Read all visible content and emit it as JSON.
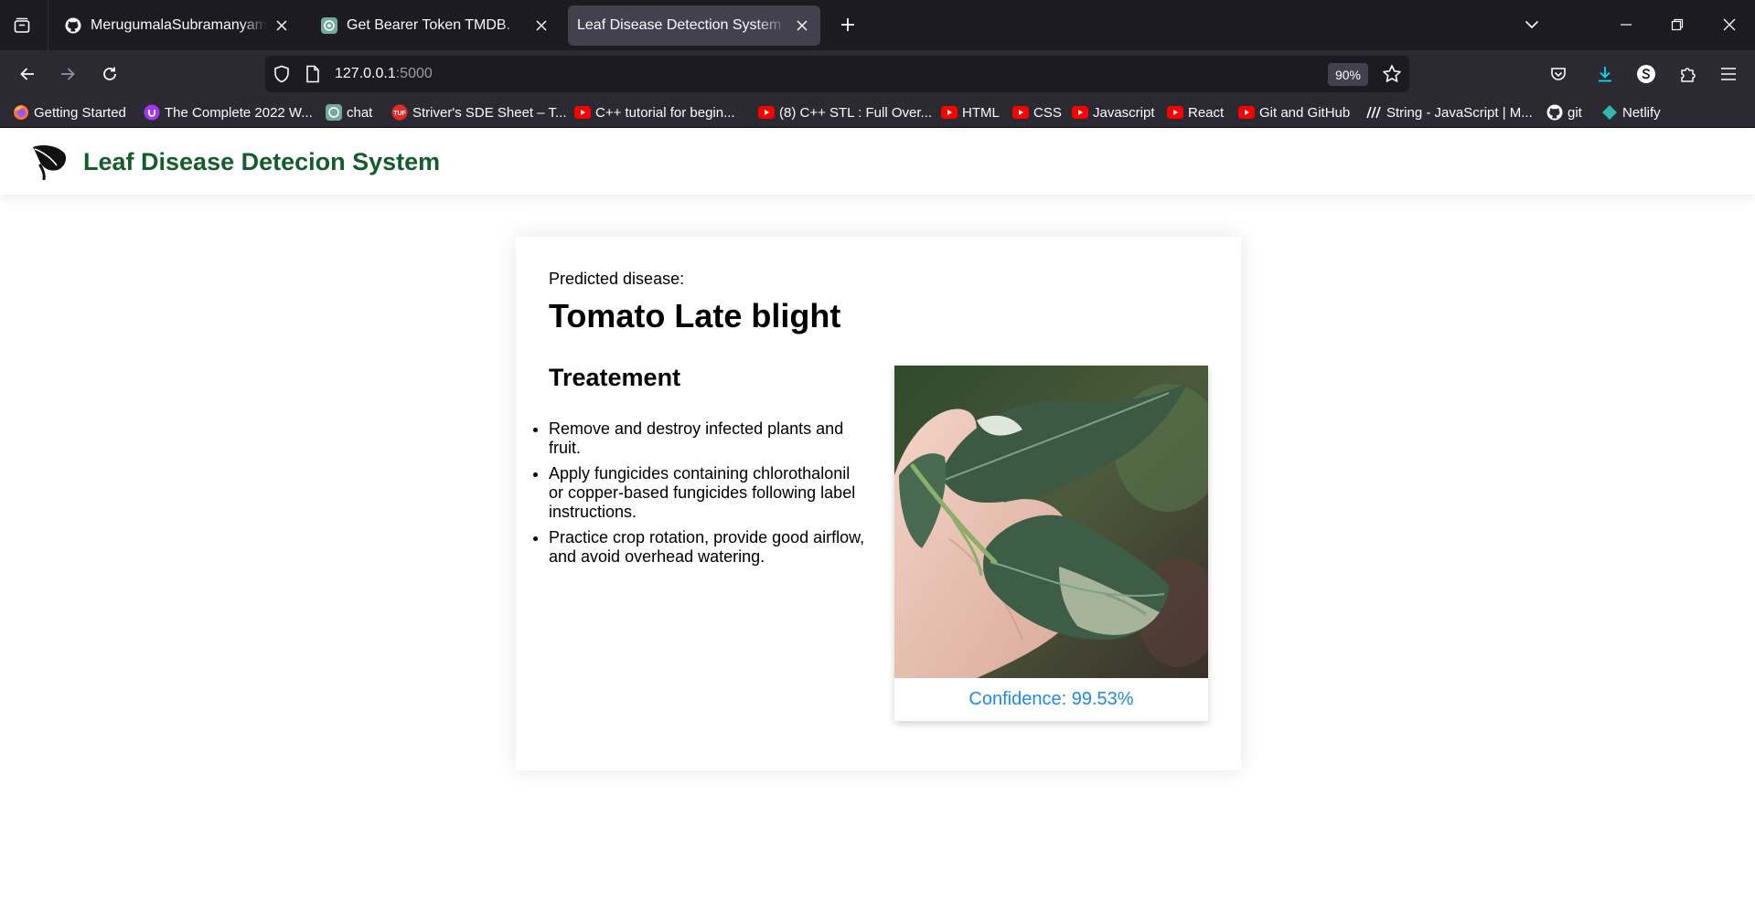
{
  "browser": {
    "tabs": [
      {
        "title": "MerugumalaSubramanyam (sub",
        "icon": "github-icon",
        "active": false
      },
      {
        "title": "Get Bearer Token TMDB.",
        "icon": "chatgpt-icon",
        "active": false
      },
      {
        "title": "Leaf Disease Detection System",
        "icon": "none",
        "active": true
      }
    ],
    "url": {
      "host": "127.0.0.1",
      "port": ":5000"
    },
    "zoom": "90%",
    "bookmarks": [
      {
        "label": "Getting Started",
        "icon": "firefox-icon"
      },
      {
        "label": "The Complete 2022 W...",
        "icon": "udemy-icon"
      },
      {
        "label": "chat",
        "icon": "chatgpt-icon"
      },
      {
        "label": "Striver's SDE Sheet – T...",
        "icon": "tuf-icon"
      },
      {
        "label": "C++ tutorial for begin...",
        "icon": "youtube-icon"
      },
      {
        "label": "(8) C++ STL : Full Over...",
        "icon": "youtube-icon"
      },
      {
        "label": "HTML",
        "icon": "youtube-icon"
      },
      {
        "label": "CSS",
        "icon": "youtube-icon"
      },
      {
        "label": "Javascript",
        "icon": "youtube-icon"
      },
      {
        "label": "React",
        "icon": "youtube-icon"
      },
      {
        "label": "Git and GitHub",
        "icon": "youtube-icon"
      },
      {
        "label": "String - JavaScript | M...",
        "icon": "mdn-icon"
      },
      {
        "label": "git",
        "icon": "github-icon"
      },
      {
        "label": "Netlify",
        "icon": "netlify-icon"
      }
    ]
  },
  "site": {
    "title": "Leaf Disease Detecion System",
    "logo_icon": "leaf-icon",
    "title_color": "#145c2a"
  },
  "result": {
    "label": "Predicted disease:",
    "disease": "Tomato Late blight",
    "treatment_title": "Treatement",
    "treatments": [
      "Remove and destroy infected plants and fruit.",
      "Apply fungicides containing chlorothalonil or copper-based fungicides following label instructions.",
      "Practice crop rotation, provide good airflow, and avoid overhead watering."
    ],
    "confidence": "Confidence: 99.53%",
    "confidence_color": "#1f8ae6"
  }
}
